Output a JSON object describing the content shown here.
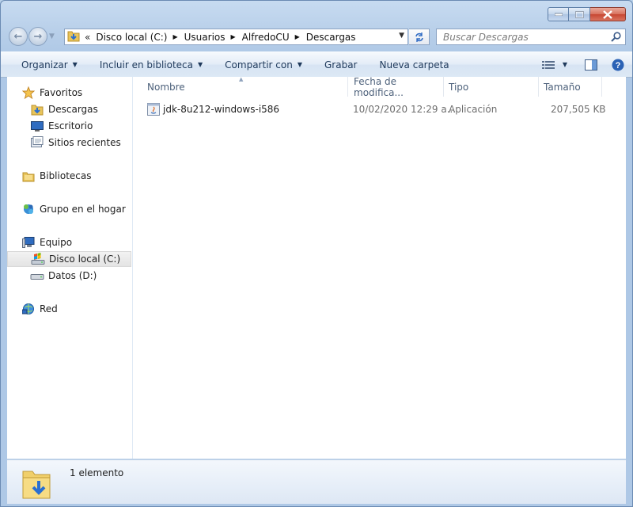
{
  "window": {
    "caption_buttons": [
      "minimize",
      "maximize",
      "close"
    ]
  },
  "address_bar": {
    "overflow_chevron": "«",
    "breadcrumbs": [
      "Disco local (C:)",
      "Usuarios",
      "AlfredoCU",
      "Descargas"
    ]
  },
  "search": {
    "placeholder": "Buscar Descargas"
  },
  "toolbar": {
    "organize": "Organizar",
    "include_library": "Incluir en biblioteca",
    "share": "Compartir con",
    "burn": "Grabar",
    "new_folder": "Nueva carpeta"
  },
  "nav_pane": {
    "favorites": "Favoritos",
    "downloads": "Descargas",
    "desktop": "Escritorio",
    "recent": "Sitios recientes",
    "libraries": "Bibliotecas",
    "homegroup": "Grupo en el hogar",
    "computer": "Equipo",
    "local_disk": "Disco local (C:)",
    "data_disk": "Datos (D:)",
    "network": "Red"
  },
  "columns": {
    "name": "Nombre",
    "date": "Fecha de modifica...",
    "type": "Tipo",
    "size": "Tamaño"
  },
  "files": [
    {
      "name": "jdk-8u212-windows-i586",
      "date": "10/02/2020 12:29 a...",
      "type": "Aplicación",
      "size": "207,505 KB"
    }
  ],
  "status": {
    "count": "1 elemento"
  },
  "colors": {
    "toolbar_text": "#1e395b",
    "column_header_text": "#4c607a",
    "window_frame": "#b9d1ea",
    "close_button": "#c74632"
  }
}
